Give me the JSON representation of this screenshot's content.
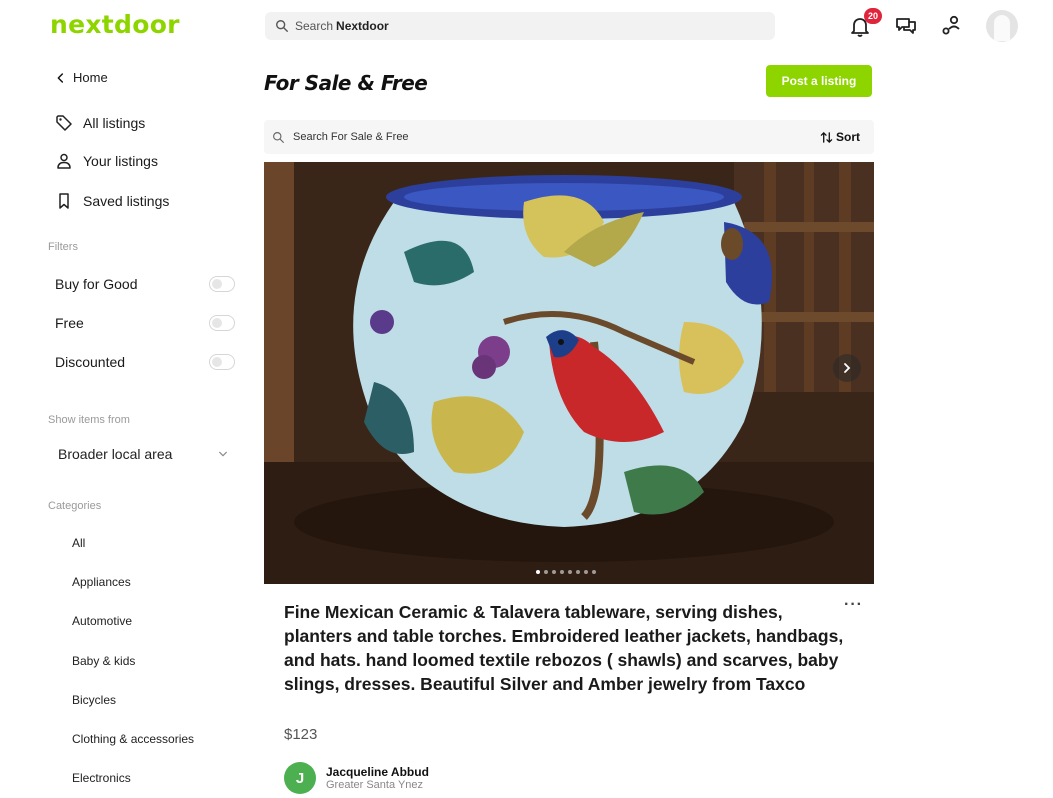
{
  "header": {
    "logo": "nextdoor",
    "search_placeholder_prefix": "Search",
    "search_placeholder_bold": "Nextdoor",
    "notification_count": "20"
  },
  "sidebar": {
    "home": "Home",
    "items": [
      {
        "label": "All listings",
        "icon": "tag-icon"
      },
      {
        "label": "Your listings",
        "icon": "person-icon"
      },
      {
        "label": "Saved listings",
        "icon": "bookmark-icon"
      }
    ],
    "filters_label": "Filters",
    "filters": [
      {
        "label": "Buy for Good",
        "on": false
      },
      {
        "label": "Free",
        "on": false
      },
      {
        "label": "Discounted",
        "on": false
      }
    ],
    "show_items_label": "Show items from",
    "area": "Broader local area",
    "categories_label": "Categories",
    "categories": [
      "All",
      "Appliances",
      "Automotive",
      "Baby & kids",
      "Bicycles",
      "Clothing & accessories",
      "Electronics"
    ]
  },
  "main": {
    "title": "For Sale & Free",
    "post_button": "Post a listing",
    "search_placeholder": "Search For Sale & Free",
    "sort_label": "Sort",
    "photo_count": 8,
    "active_photo": 1
  },
  "listing": {
    "title": "Fine Mexican Ceramic & Talavera tableware, serving dishes, planters and table torches. Embroidered leather jackets, handbags, and hats. hand loomed textile rebozos ( shawls) and scarves, baby slings, dresses. Beautiful Silver and Amber jewelry from Taxco",
    "price": "$123",
    "seller_initial": "J",
    "seller_name": "Jacqueline Abbud",
    "seller_area": "Greater Santa Ynez"
  },
  "colors": {
    "brand_green": "#8ed500",
    "badge_red": "#e0243c",
    "seller_avatar": "#4caf50"
  }
}
